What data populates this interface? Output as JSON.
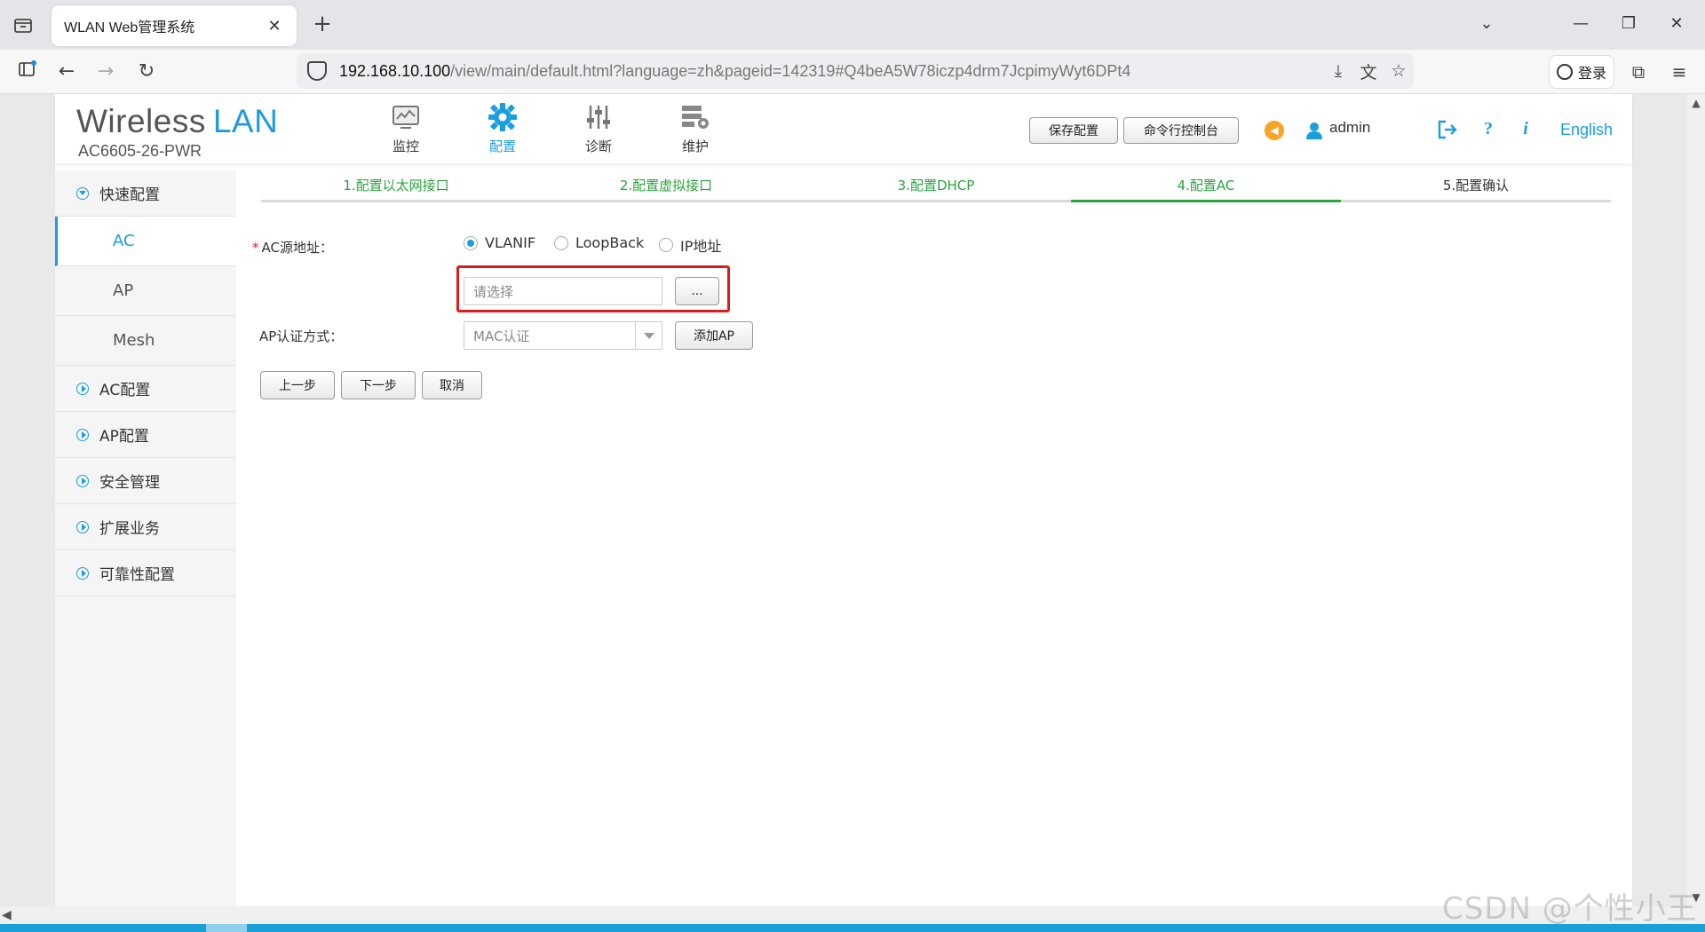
{
  "browser": {
    "tab_title": "WLAN Web管理系统",
    "url_host": "192.168.10.100",
    "url_path": "/view/main/default.html?language=zh&pageid=142319#Q4beA5W78iczp4drm7JcpimyWyt6DPt4",
    "login_label": "登录",
    "new_tab": "+",
    "close_tab": "✕"
  },
  "header": {
    "brand_a": "Wireless",
    "brand_b": "LAN",
    "model": "AC6605-26-PWR",
    "nav": [
      {
        "label": "监控",
        "icon": "monitor-icon"
      },
      {
        "label": "配置",
        "icon": "gear-icon"
      },
      {
        "label": "诊断",
        "icon": "sliders-icon"
      },
      {
        "label": "维护",
        "icon": "maintenance-icon"
      }
    ],
    "save_config": "保存配置",
    "cli_console": "命令行控制台",
    "user": "admin",
    "lang": "English",
    "accent_color": "#1a9ee0"
  },
  "sidebar": {
    "quick_config": "快速配置",
    "sub_items": [
      "AC",
      "AP",
      "Mesh"
    ],
    "groups": [
      "AC配置",
      "AP配置",
      "安全管理",
      "扩展业务",
      "可靠性配置"
    ]
  },
  "steps": [
    "1.配置以太网接口",
    "2.配置虚拟接口",
    "3.配置DHCP",
    "4.配置AC",
    "5.配置确认"
  ],
  "form": {
    "ac_source_label": "AC源地址：",
    "ac_source_options": [
      "VLANIF",
      "LoopBack",
      "IP地址"
    ],
    "ac_source_selected": "VLANIF",
    "select_placeholder": "请选择",
    "browse_label": "...",
    "ap_auth_label": "AP认证方式：",
    "ap_auth_value": "MAC认证",
    "add_ap": "添加AP",
    "prev": "上一步",
    "next": "下一步",
    "cancel": "取消"
  },
  "watermark": "CSDN @个性小王"
}
